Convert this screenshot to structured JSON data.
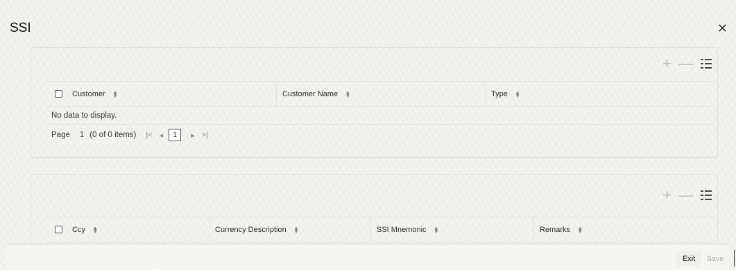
{
  "window": {
    "title": "SSI"
  },
  "toolbar": {
    "add": "+",
    "remove": "—"
  },
  "grid1": {
    "columns": [
      "Customer",
      "Customer Name",
      "Type"
    ],
    "empty_text": "No data to display.",
    "pager": {
      "page_label": "Page",
      "page_number": "1",
      "items_text": "(0 of 0 items)",
      "first": "|<",
      "prev": "◂",
      "current": "1",
      "next": "▸",
      "last": ">|"
    }
  },
  "grid2": {
    "columns": [
      "Ccy",
      "Currency Description",
      "SSI Mnemonic",
      "Remarks"
    ]
  },
  "footer": {
    "exit": "Exit",
    "save": "Save"
  }
}
